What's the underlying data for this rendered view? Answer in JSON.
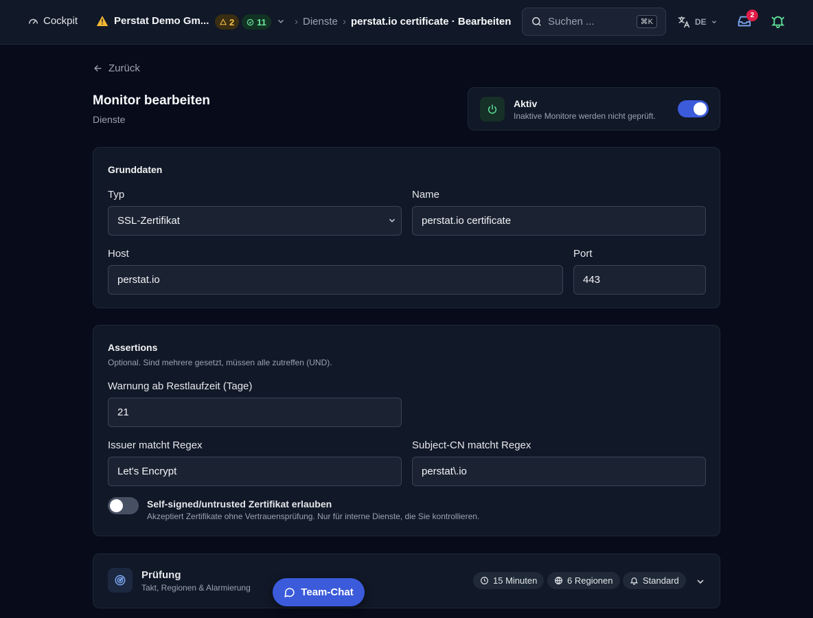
{
  "topbar": {
    "cockpit_label": "Cockpit",
    "org_name": "Perstat Demo Gm...",
    "warn_count": "2",
    "ok_count": "11",
    "breadcrumb": [
      "Dienste",
      "perstat.io certificate · Bearbeiten"
    ],
    "search_placeholder": "Suchen ...",
    "search_shortcut": "⌘K",
    "language": "DE",
    "inbox_badge": "2"
  },
  "page": {
    "back_label": "Zurück",
    "title": "Monitor bearbeiten",
    "subtitle": "Dienste"
  },
  "active": {
    "title": "Aktiv",
    "description": "Inaktive Monitore werden nicht geprüft.",
    "enabled": true
  },
  "basics": {
    "title": "Grunddaten",
    "type_label": "Typ",
    "type_value": "SSL-Zertifikat",
    "name_label": "Name",
    "name_value": "perstat.io certificate",
    "host_label": "Host",
    "host_value": "perstat.io",
    "port_label": "Port",
    "port_value": "443"
  },
  "assertions": {
    "title": "Assertions",
    "hint": "Optional. Sind mehrere gesetzt, müssen alle zutreffen (UND).",
    "warn_label": "Warnung ab Restlaufzeit (Tage)",
    "warn_value": "21",
    "issuer_label": "Issuer matcht Regex",
    "issuer_value": "Let's Encrypt",
    "subject_label": "Subject-CN matcht Regex",
    "subject_value": "perstat\\.io",
    "selfsigned_label": "Self-signed/untrusted Zertifikat erlauben",
    "selfsigned_hint": "Akzeptiert Zertifikate ohne Vertrauensprüfung. Nur für interne Dienste, die Sie kontrollieren.",
    "selfsigned_enabled": false
  },
  "check": {
    "title": "Prüfung",
    "subtitle": "Takt, Regionen & Alarmierung",
    "interval": "15 Minuten",
    "regions": "6 Regionen",
    "alerting": "Standard"
  },
  "teamchat_label": "Team-Chat",
  "colors": {
    "accent": "#3b5bdb",
    "background": "#070b1a",
    "card": "#111827",
    "success": "#6ee7a0",
    "warning": "#f5c04a",
    "danger": "#e11d48"
  }
}
